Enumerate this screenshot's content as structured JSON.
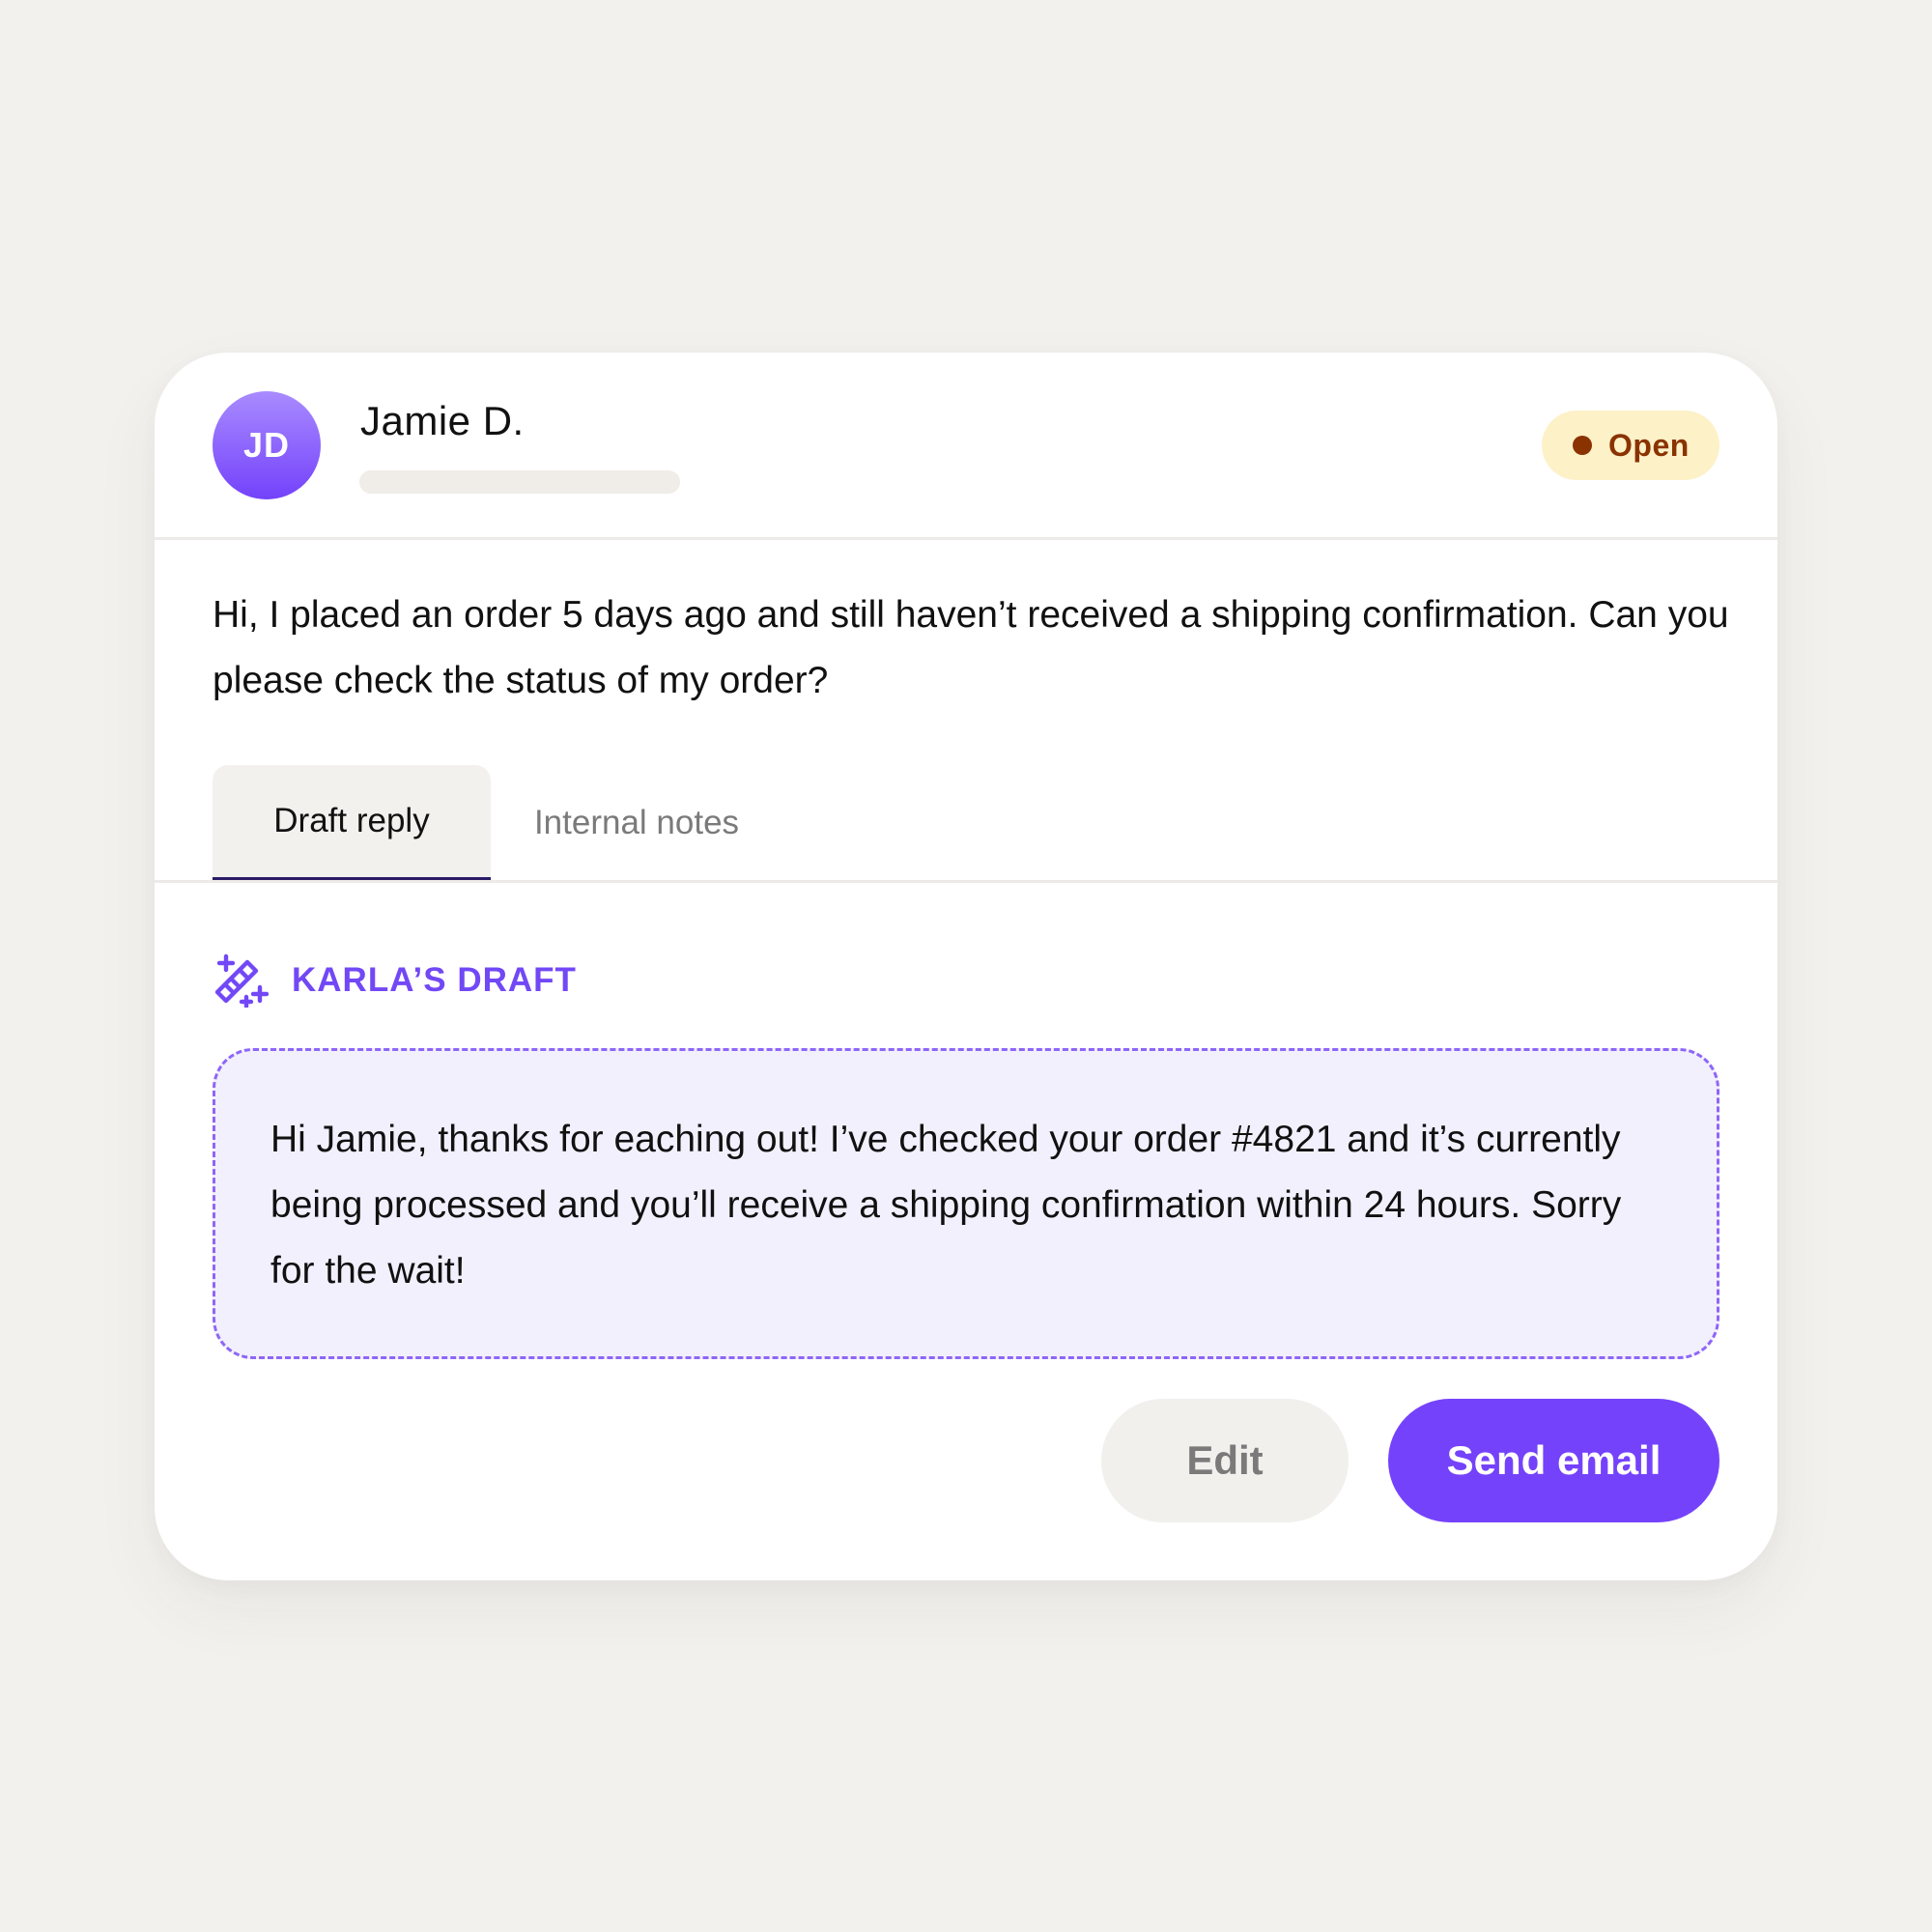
{
  "ticket": {
    "avatar_initials": "JD",
    "sender_name": "Jamie D.",
    "status": "Open",
    "message": "Hi, I placed an order 5 days ago and still haven’t received a shipping confirmation. Can you please check the status of my order?"
  },
  "tabs": [
    {
      "label": "Draft reply",
      "active": true
    },
    {
      "label": "Internal notes",
      "active": false
    }
  ],
  "draft": {
    "icon": "magic-wand-icon",
    "label": "KARLA’S DRAFT",
    "text": "Hi Jamie, thanks for eaching out! I’ve checked your order #4821 and it’s currently being processed and you’ll receive a shipping confirmation within 24 hours. Sorry for the wait!"
  },
  "actions": {
    "edit_label": "Edit",
    "send_label": "Send email"
  },
  "colors": {
    "accent": "#7542fb",
    "status_bg": "#fdf1c8",
    "status_text": "#8a3200",
    "draft_bg": "#f2f0fd"
  }
}
